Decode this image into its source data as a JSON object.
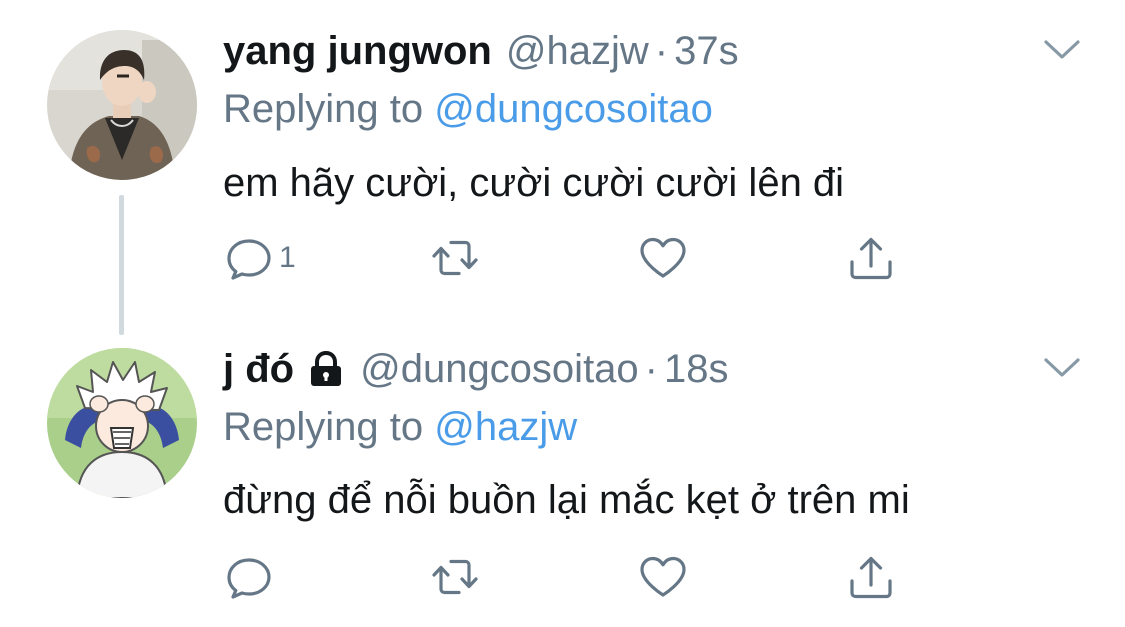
{
  "colors": {
    "text": "#14171a",
    "secondary": "#657786",
    "mention": "#4a9ce8",
    "thread_line": "#cfd9de"
  },
  "tweets": [
    {
      "display_name": "yang jungwon",
      "handle": "@hazjw",
      "separator": "·",
      "time": "37s",
      "replying_prefix": "Replying to",
      "replying_to": "@dungcosoitao",
      "text": "em hãy cười, cười cười cười lên đi",
      "reply_count": "1",
      "protected": false,
      "icons": [
        "reply-icon",
        "retweet-icon",
        "like-icon",
        "share-icon",
        "chevron-down-icon"
      ]
    },
    {
      "display_name": "j đó",
      "handle": "@dungcosoitao",
      "separator": "·",
      "time": "18s",
      "replying_prefix": "Replying to",
      "replying_to": "@hazjw",
      "text": "đừng để nỗi buồn lại mắc kẹt ở trên mi",
      "reply_count": "",
      "protected": true,
      "icons": [
        "lock-icon",
        "reply-icon",
        "retweet-icon",
        "like-icon",
        "share-icon",
        "chevron-down-icon"
      ]
    }
  ]
}
